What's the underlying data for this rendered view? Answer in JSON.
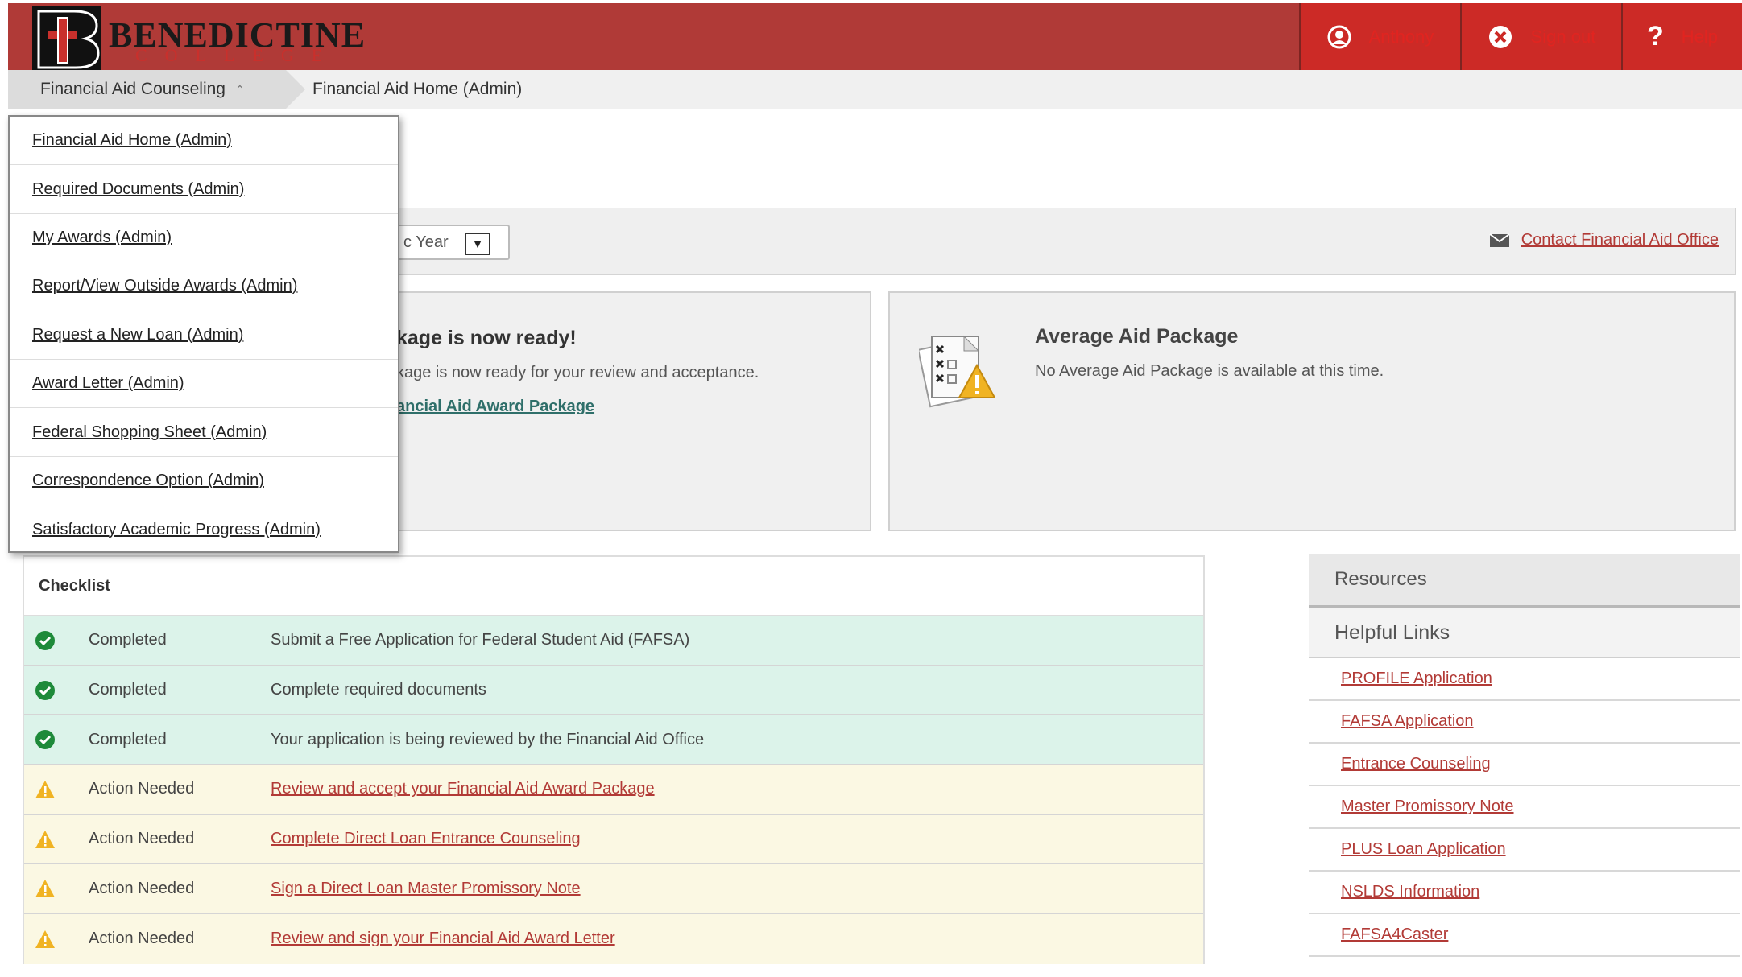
{
  "header": {
    "logo_text": "BENEDICTINE",
    "logo_sub": "COLLEGE",
    "buttons": [
      {
        "label": "Anthony",
        "icon": "user-icon"
      },
      {
        "label": "Sign out",
        "icon": "close-circle-icon"
      },
      {
        "label": "Help",
        "icon": "help-icon"
      }
    ],
    "colors": {
      "bar": "#b03a37",
      "button": "#cc2a26"
    }
  },
  "breadcrumb": {
    "section": "Financial Aid Counseling",
    "current": "Financial Aid Home (Admin)"
  },
  "dropdown": {
    "items": [
      "Financial Aid Home (Admin)",
      "Required Documents (Admin)",
      "My Awards (Admin)",
      "Report/View Outside Awards (Admin)",
      "Request a New Loan (Admin)",
      "Award Letter (Admin)",
      "Federal Shopping Sheet (Admin)",
      "Correspondence Option (Admin)",
      "Satisfactory Academic Progress (Admin)"
    ]
  },
  "filter": {
    "year_value": "c Year",
    "contact_link": "Contact Financial Aid Office"
  },
  "award_panel": {
    "title": "kage is now ready!",
    "text": "kage is now ready for your review and acceptance.",
    "link": "ancial Aid Award Package"
  },
  "average_panel": {
    "title": "Average Aid Package",
    "text": "No Average Aid Package is available at this time."
  },
  "checklist": {
    "title": "Checklist",
    "rows": [
      {
        "status": "Completed",
        "desc": "Submit a Free Application for Federal Student Aid (FAFSA)",
        "state": "ok"
      },
      {
        "status": "Completed",
        "desc": "Complete required documents",
        "state": "ok"
      },
      {
        "status": "Completed",
        "desc": "Your application is being reviewed by the Financial Aid Office",
        "state": "ok"
      },
      {
        "status": "Action Needed",
        "desc": "Review and accept your Financial Aid Award Package",
        "state": "warn"
      },
      {
        "status": "Action Needed",
        "desc": "Complete Direct Loan Entrance Counseling",
        "state": "warn"
      },
      {
        "status": "Action Needed",
        "desc": "Sign a Direct Loan Master Promissory Note",
        "state": "warn"
      },
      {
        "status": "Action Needed",
        "desc": "Review and sign your Financial Aid Award Letter",
        "state": "warn"
      }
    ]
  },
  "resources": {
    "title": "Resources",
    "subtitle": "Helpful Links",
    "links": [
      "PROFILE Application",
      "FAFSA Application",
      "Entrance Counseling",
      "Master Promissory Note",
      "PLUS Loan Application",
      "NSLDS Information",
      "FAFSA4Caster"
    ]
  }
}
